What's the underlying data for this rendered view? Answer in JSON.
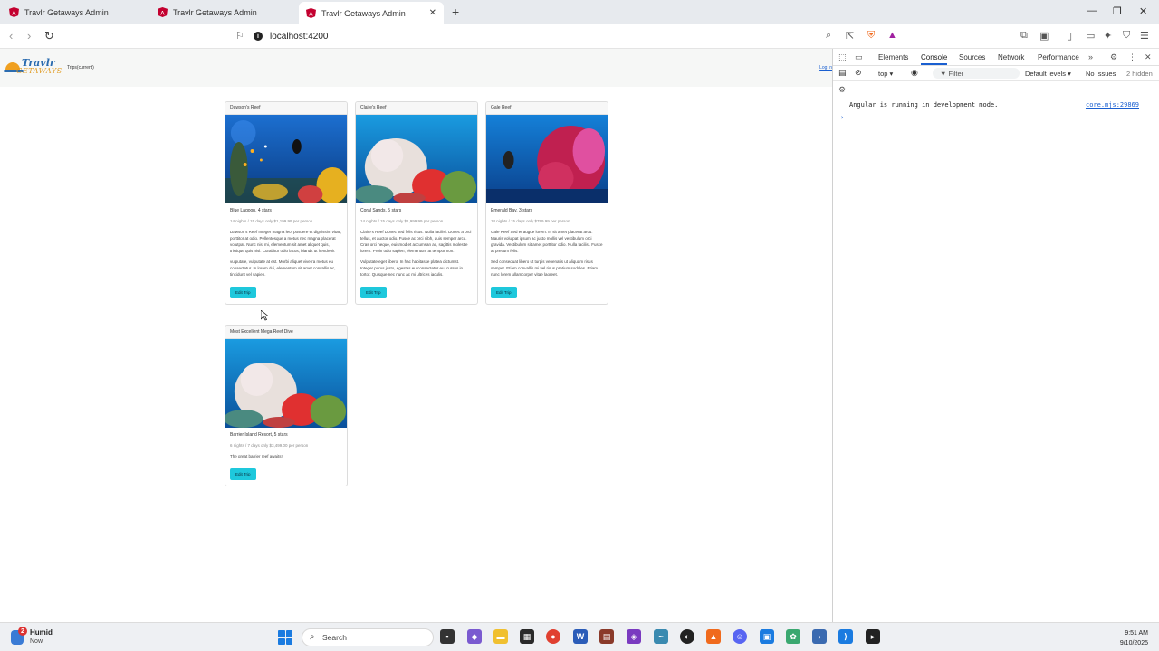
{
  "browser": {
    "tabs": [
      {
        "title": "Travlr Getaways Admin",
        "active": false
      },
      {
        "title": "Travlr Getaways Admin",
        "active": false
      },
      {
        "title": "Travlr Getaways Admin",
        "active": true
      }
    ],
    "new_tab": "+",
    "url": "localhost:4200"
  },
  "app": {
    "logo": {
      "line1": "Travlr",
      "line2": "GETAWAYS"
    },
    "nav_link": "Trips(current)",
    "login_link": "Log In"
  },
  "trips": [
    {
      "header": "Dawson's Reef",
      "resort": "Blue Lagoon, 4 stars",
      "pricing": "14 nights / 15 days only $1,199.99 per person",
      "desc1": "Dawson's Reef Integer magna leo, posuere et dignissim vitae, porttitor at odio. Pellentesque a metus nec magna placerat volutpat. Nunc nisi mi, elementum sit amet aliquet quis, tristique quis nisl. Curabitur odio lacus, blandit ut hendrerit",
      "desc2": "vulputate, vulputate at est. Morbi aliquet viverra metus eu consectetur. In lorem dui, elementum sit amet convallis ac, tincidunt vel sapien.",
      "button": "Edit Trip"
    },
    {
      "header": "Claire's Reef",
      "resort": "Coral Sands, 5 stars",
      "pricing": "14 nights / 15 days only $1,999.99 per person",
      "desc1": "Claire's Reef Donec sed felis risus. Nulla facilisi. Donec a orci tellus, et auctor odio. Fusce ac orci nibh, quis semper arcu. Cras orci neque, euismod et accumsan ac, sagittis molestie lorem. Proin odio sapien, elementum at tempor non.",
      "desc2": "Vulputate eget libero. In hac habitasse platea dictumst. Integer purus justo, egestas eu consectetur eu, cursus in tortor. Quisque nec nunc ac mi ultrices iaculis.",
      "button": "Edit Trip"
    },
    {
      "header": "Gale Reef",
      "resort": "Emerald Bay, 3 stars",
      "pricing": "14 nights / 15 days only $799.99 per person",
      "desc1": "Gale Reef Sed et augue lorem. In sit amet placerat arcu. Mauris volutpat ipsum ac justo mollis vel vestibulum orci gravida. Vestibulum sit amet porttitor odio. Nulla facilisi. Fusce at pretium felis.",
      "desc2": "Sed consequat libero ut turpis venenatis ut aliquam risus semper. Etiam convallis mi vel risus pretium sodales. Etiam nunc lorem ullamcorper vitae laoreet.",
      "button": "Edit Trip"
    },
    {
      "header": "Most Excellent Mega Reef Dive",
      "resort": "Barrier Island Resort, 5 stars",
      "pricing": "6 nights / 7 days only $3,499.00 per person",
      "desc1": "The great barrier reef awaits!",
      "desc2": "",
      "button": "Edit Trip"
    }
  ],
  "devtools": {
    "tabs": [
      "Elements",
      "Console",
      "Sources",
      "Network",
      "Performance"
    ],
    "active_tab": "Console",
    "context": "top ▾",
    "filter_placeholder": "Filter",
    "levels": "Default levels ▾",
    "issues": "No Issues",
    "hidden": "2 hidden",
    "console_message": "Angular is running in development mode.",
    "console_source": "core.mjs:29869",
    "prompt": "›"
  },
  "taskbar": {
    "weather_title": "Humid",
    "weather_sub": "Now",
    "weather_badge": "2",
    "search_placeholder": "Search",
    "time": "9:51 AM",
    "date": "9/10/2025"
  },
  "colors": {
    "accent_button": "#1ec8dc",
    "devtools_active": "#1a5fd0",
    "angular_favicon": "#c3002f"
  }
}
